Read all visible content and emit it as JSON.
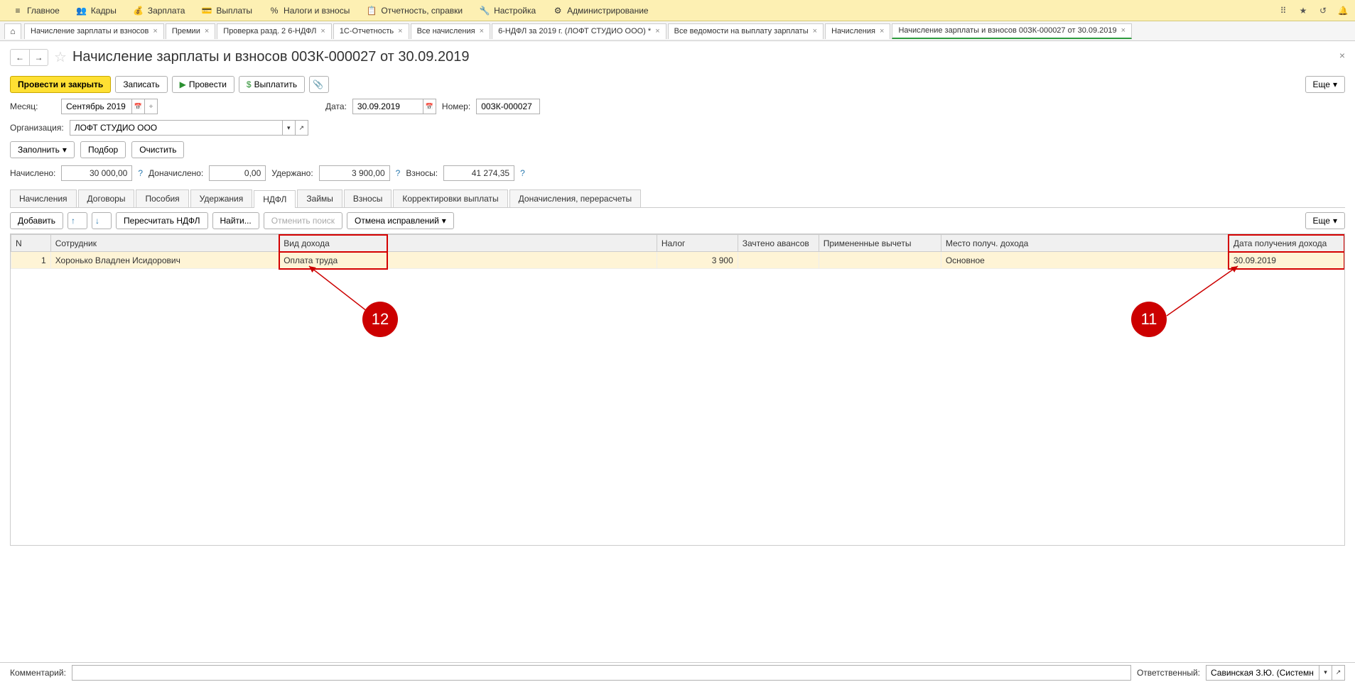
{
  "top_menu": {
    "items": [
      {
        "label": "Главное"
      },
      {
        "label": "Кадры"
      },
      {
        "label": "Зарплата"
      },
      {
        "label": "Выплаты"
      },
      {
        "label": "Налоги и взносы"
      },
      {
        "label": "Отчетность, справки"
      },
      {
        "label": "Настройка"
      },
      {
        "label": "Администрирование"
      }
    ]
  },
  "tabs": [
    {
      "label": "Начисление зарплаты и взносов"
    },
    {
      "label": "Премии"
    },
    {
      "label": "Проверка разд. 2 6-НДФЛ"
    },
    {
      "label": "1С-Отчетность"
    },
    {
      "label": "Все начисления"
    },
    {
      "label": "6-НДФЛ за 2019 г. (ЛОФТ СТУДИО ООО) *"
    },
    {
      "label": "Все ведомости на выплату зарплаты"
    },
    {
      "label": "Начисления"
    },
    {
      "label": "Начисление зарплаты и взносов 00ЗК-000027 от 30.09.2019",
      "active": true
    }
  ],
  "page": {
    "title": "Начисление зарплаты и взносов 00ЗК-000027 от 30.09.2019"
  },
  "commands": {
    "post_close": "Провести и закрыть",
    "save": "Записать",
    "post": "Провести",
    "pay": "Выплатить",
    "more": "Еще"
  },
  "fields": {
    "month_label": "Месяц:",
    "month_value": "Сентябрь 2019",
    "date_label": "Дата:",
    "date_value": "30.09.2019",
    "num_label": "Номер:",
    "num_value": "00ЗК-000027",
    "org_label": "Организация:",
    "org_value": "ЛОФТ СТУДИО ООО",
    "fill": "Заполнить",
    "pick": "Подбор",
    "clear": "Очистить"
  },
  "summary": {
    "accrued_label": "Начислено:",
    "accrued": "30 000,00",
    "add_accrued_label": "Доначислено:",
    "add_accrued": "0,00",
    "withheld_label": "Удержано:",
    "withheld": "3 900,00",
    "contrib_label": "Взносы:",
    "contrib": "41 274,35"
  },
  "inner_tabs": [
    {
      "label": "Начисления"
    },
    {
      "label": "Договоры"
    },
    {
      "label": "Пособия"
    },
    {
      "label": "Удержания"
    },
    {
      "label": "НДФЛ",
      "active": true
    },
    {
      "label": "Займы"
    },
    {
      "label": "Взносы"
    },
    {
      "label": "Корректировки выплаты"
    },
    {
      "label": "Доначисления, перерасчеты"
    }
  ],
  "inner_toolbar": {
    "add": "Добавить",
    "recalc": "Пересчитать НДФЛ",
    "find": "Найти...",
    "cancel_search": "Отменить поиск",
    "cancel_fix": "Отмена исправлений",
    "more": "Еще"
  },
  "table": {
    "headers": {
      "n": "N",
      "employee": "Сотрудник",
      "income_type": "Вид дохода",
      "tax": "Налог",
      "advance": "Зачтено авансов",
      "deductions": "Примененные вычеты",
      "place": "Место получ. дохода",
      "income_date": "Дата получения дохода"
    },
    "rows": [
      {
        "n": "1",
        "employee": "Хоронько Владлен Исидорович",
        "income_type": "Оплата труда",
        "tax": "3 900",
        "advance": "",
        "deductions": "",
        "place": "Основное",
        "income_date": "30.09.2019"
      }
    ]
  },
  "footer": {
    "comment_label": "Комментарий:",
    "comment_value": "",
    "resp_label": "Ответственный:",
    "resp_value": "Савинская З.Ю. (Системн"
  },
  "annotations": {
    "a11": "11",
    "a12": "12"
  }
}
